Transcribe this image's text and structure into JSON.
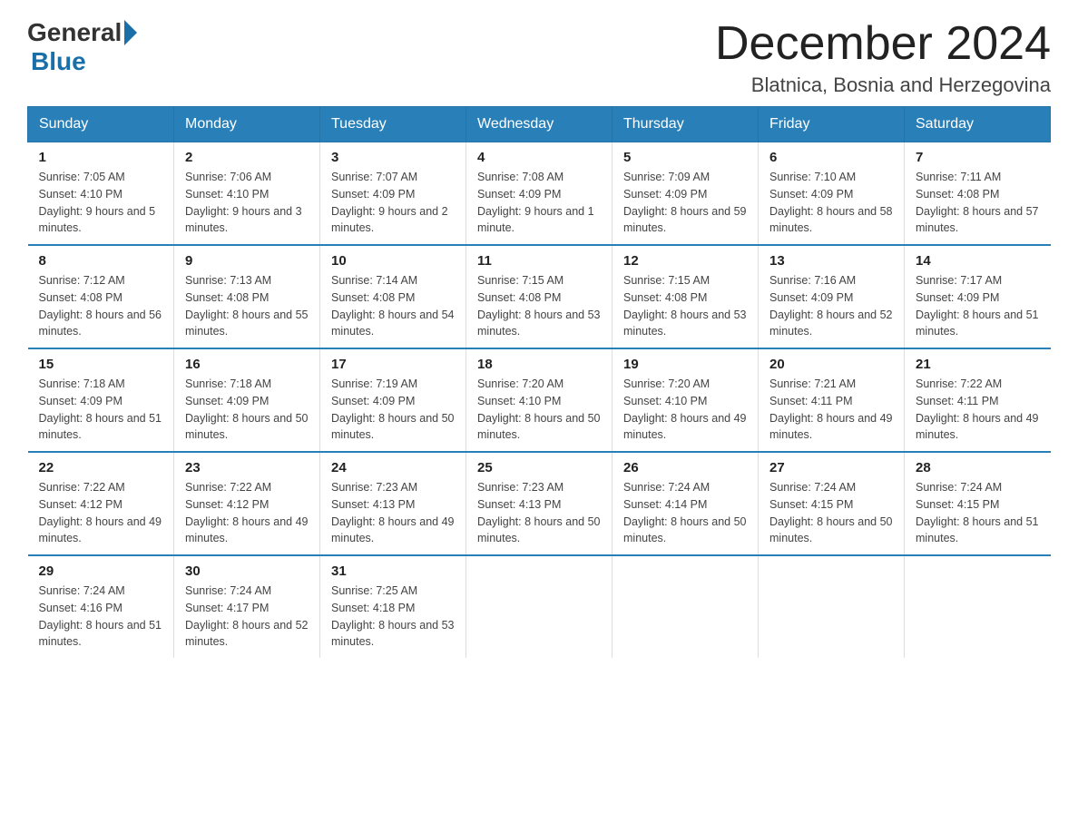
{
  "header": {
    "logo_general": "General",
    "logo_blue": "Blue",
    "month_title": "December 2024",
    "location": "Blatnica, Bosnia and Herzegovina"
  },
  "columns": [
    "Sunday",
    "Monday",
    "Tuesday",
    "Wednesday",
    "Thursday",
    "Friday",
    "Saturday"
  ],
  "weeks": [
    [
      {
        "day": "1",
        "sunrise": "7:05 AM",
        "sunset": "4:10 PM",
        "daylight": "9 hours and 5 minutes."
      },
      {
        "day": "2",
        "sunrise": "7:06 AM",
        "sunset": "4:10 PM",
        "daylight": "9 hours and 3 minutes."
      },
      {
        "day": "3",
        "sunrise": "7:07 AM",
        "sunset": "4:09 PM",
        "daylight": "9 hours and 2 minutes."
      },
      {
        "day": "4",
        "sunrise": "7:08 AM",
        "sunset": "4:09 PM",
        "daylight": "9 hours and 1 minute."
      },
      {
        "day": "5",
        "sunrise": "7:09 AM",
        "sunset": "4:09 PM",
        "daylight": "8 hours and 59 minutes."
      },
      {
        "day": "6",
        "sunrise": "7:10 AM",
        "sunset": "4:09 PM",
        "daylight": "8 hours and 58 minutes."
      },
      {
        "day": "7",
        "sunrise": "7:11 AM",
        "sunset": "4:08 PM",
        "daylight": "8 hours and 57 minutes."
      }
    ],
    [
      {
        "day": "8",
        "sunrise": "7:12 AM",
        "sunset": "4:08 PM",
        "daylight": "8 hours and 56 minutes."
      },
      {
        "day": "9",
        "sunrise": "7:13 AM",
        "sunset": "4:08 PM",
        "daylight": "8 hours and 55 minutes."
      },
      {
        "day": "10",
        "sunrise": "7:14 AM",
        "sunset": "4:08 PM",
        "daylight": "8 hours and 54 minutes."
      },
      {
        "day": "11",
        "sunrise": "7:15 AM",
        "sunset": "4:08 PM",
        "daylight": "8 hours and 53 minutes."
      },
      {
        "day": "12",
        "sunrise": "7:15 AM",
        "sunset": "4:08 PM",
        "daylight": "8 hours and 53 minutes."
      },
      {
        "day": "13",
        "sunrise": "7:16 AM",
        "sunset": "4:09 PM",
        "daylight": "8 hours and 52 minutes."
      },
      {
        "day": "14",
        "sunrise": "7:17 AM",
        "sunset": "4:09 PM",
        "daylight": "8 hours and 51 minutes."
      }
    ],
    [
      {
        "day": "15",
        "sunrise": "7:18 AM",
        "sunset": "4:09 PM",
        "daylight": "8 hours and 51 minutes."
      },
      {
        "day": "16",
        "sunrise": "7:18 AM",
        "sunset": "4:09 PM",
        "daylight": "8 hours and 50 minutes."
      },
      {
        "day": "17",
        "sunrise": "7:19 AM",
        "sunset": "4:09 PM",
        "daylight": "8 hours and 50 minutes."
      },
      {
        "day": "18",
        "sunrise": "7:20 AM",
        "sunset": "4:10 PM",
        "daylight": "8 hours and 50 minutes."
      },
      {
        "day": "19",
        "sunrise": "7:20 AM",
        "sunset": "4:10 PM",
        "daylight": "8 hours and 49 minutes."
      },
      {
        "day": "20",
        "sunrise": "7:21 AM",
        "sunset": "4:11 PM",
        "daylight": "8 hours and 49 minutes."
      },
      {
        "day": "21",
        "sunrise": "7:22 AM",
        "sunset": "4:11 PM",
        "daylight": "8 hours and 49 minutes."
      }
    ],
    [
      {
        "day": "22",
        "sunrise": "7:22 AM",
        "sunset": "4:12 PM",
        "daylight": "8 hours and 49 minutes."
      },
      {
        "day": "23",
        "sunrise": "7:22 AM",
        "sunset": "4:12 PM",
        "daylight": "8 hours and 49 minutes."
      },
      {
        "day": "24",
        "sunrise": "7:23 AM",
        "sunset": "4:13 PM",
        "daylight": "8 hours and 49 minutes."
      },
      {
        "day": "25",
        "sunrise": "7:23 AM",
        "sunset": "4:13 PM",
        "daylight": "8 hours and 50 minutes."
      },
      {
        "day": "26",
        "sunrise": "7:24 AM",
        "sunset": "4:14 PM",
        "daylight": "8 hours and 50 minutes."
      },
      {
        "day": "27",
        "sunrise": "7:24 AM",
        "sunset": "4:15 PM",
        "daylight": "8 hours and 50 minutes."
      },
      {
        "day": "28",
        "sunrise": "7:24 AM",
        "sunset": "4:15 PM",
        "daylight": "8 hours and 51 minutes."
      }
    ],
    [
      {
        "day": "29",
        "sunrise": "7:24 AM",
        "sunset": "4:16 PM",
        "daylight": "8 hours and 51 minutes."
      },
      {
        "day": "30",
        "sunrise": "7:24 AM",
        "sunset": "4:17 PM",
        "daylight": "8 hours and 52 minutes."
      },
      {
        "day": "31",
        "sunrise": "7:25 AM",
        "sunset": "4:18 PM",
        "daylight": "8 hours and 53 minutes."
      },
      null,
      null,
      null,
      null
    ]
  ]
}
